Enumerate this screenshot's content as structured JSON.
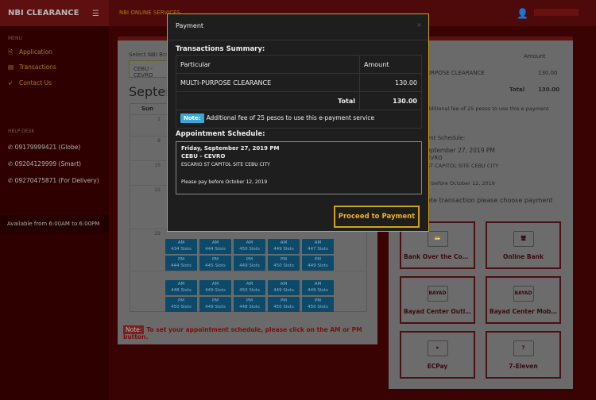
{
  "header": {
    "brand": "NBI CLEARANCE",
    "menu_icon": "hamburger",
    "service": "NBI ONLINE SERVICES",
    "user_icon": "user"
  },
  "sidebar": {
    "menu_label": "MENU",
    "items": [
      {
        "label": "Application",
        "icon": "file"
      },
      {
        "label": "Transactions",
        "icon": "list"
      },
      {
        "label": "Contact Us",
        "icon": "send"
      }
    ],
    "helpdesk_label": "HELP DESK",
    "phones": [
      "09179999421 (Globe)",
      "09204129999 (Smart)",
      "09270475871 (For Delivery)"
    ],
    "availability": "Available from 6:00AM to 6:00PM"
  },
  "calendar": {
    "branch_label": "Select NBI Branch",
    "branch_value": "CEBU - CEVRO",
    "month": "September",
    "dow": [
      "Sun"
    ],
    "days": [
      "1",
      "8",
      "15",
      "22",
      "29"
    ],
    "slots": [
      {
        "am": [
          "434 Slots",
          "444 Slots",
          "450 Slots",
          "449 Slots",
          "447 Slots"
        ],
        "pm": [
          "444 Slots",
          "445 Slots",
          "449 Slots",
          "450 Slots",
          "449 Slots"
        ]
      },
      {
        "am": [
          "448 Slots",
          "449 Slots",
          "450 Slots",
          "449 Slots",
          "449 Slots"
        ],
        "pm": [
          "450 Slots",
          "449 Slots",
          "448 Slots",
          "450 Slots",
          "450 Slots"
        ]
      }
    ],
    "am": "AM",
    "pm": "PM",
    "note_badge": "Note:",
    "note": "To set your appointment schedule, please click on the AM or PM button."
  },
  "right": {
    "particular": "r",
    "amount": "Amount",
    "item": "URPOSE CLEARANCE",
    "item_amount": "130.00",
    "total_label": "Total",
    "total": "130.00",
    "note": "dditional fee of 25 pesos to use this e-payment",
    "sched_label": "ent Schedule:",
    "sched_date": "eptember 27, 2019 PM",
    "branch": "EVRO",
    "address": "ST CAPITOL SITE CEBU CITY",
    "pay_before": "y before October 12, 2019",
    "choose": "ete transaction please choose payment",
    "options": [
      {
        "label": "Bank Over the Cou...",
        "icon": "bank-card"
      },
      {
        "label": "Online Bank",
        "icon": "monitor"
      },
      {
        "label": "Bayad Center Outlets",
        "icon": "bayad-center"
      },
      {
        "label": "Bayad Center Mobil...",
        "icon": "bayad-center"
      },
      {
        "label": "ECPay",
        "icon": "ecpay"
      },
      {
        "label": "7-Eleven",
        "icon": "7-eleven"
      }
    ]
  },
  "modal": {
    "title": "Payment",
    "close": "×",
    "summary_title": "Transactions Summary:",
    "col_particular": "Particular",
    "col_amount": "Amount",
    "item": "MULTI-PURPOSE CLEARANCE",
    "item_amount": "130.00",
    "total_label": "Total",
    "total": "130.00",
    "note_badge": "Note:",
    "note": "Additional fee of 25 pesos to use this e-payment service",
    "schedule_title": "Appointment Schedule:",
    "date": "Friday, September 27, 2019 PM",
    "branch": "CEBU - CEVRO",
    "address": "ESCARIO ST CAPITOL SITE CEBU CITY",
    "pay_before": "Please pay before October 12, 2019",
    "proceed": "Proceed to Payment"
  },
  "colors": {
    "brand_red": "#c21c1c",
    "accent_gold": "#d4a017",
    "slot_blue": "#1a8fd0",
    "note_blue": "#3aa8d8"
  }
}
